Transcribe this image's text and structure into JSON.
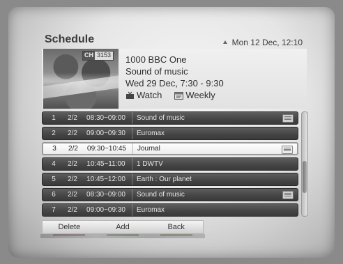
{
  "header": {
    "title": "Schedule",
    "datetime": "Mon 12 Dec, 12:10"
  },
  "program": {
    "channel_badge_label": "CH",
    "channel_badge_number": "3153",
    "channel": "1000 BBC One",
    "title": "Sound of music",
    "time": "Wed 29 Dec, 7:30 - 9:30",
    "watch_label": "Watch",
    "weekly_label": "Weekly"
  },
  "schedule": {
    "rows": [
      {
        "num": "1",
        "ep": "2/2",
        "time": "08:30~09:00",
        "name": "Sound of music",
        "icon": "weekly-icon",
        "selected": false
      },
      {
        "num": "2",
        "ep": "2/2",
        "time": "09:00~09:30",
        "name": "Euromax",
        "icon": "",
        "selected": false
      },
      {
        "num": "3",
        "ep": "2/2",
        "time": "09:30~10:45",
        "name": "Journal",
        "icon": "weekly-icon",
        "selected": true
      },
      {
        "num": "4",
        "ep": "2/2",
        "time": "10:45~11:00",
        "name": "1 DWTV",
        "icon": "",
        "selected": false
      },
      {
        "num": "5",
        "ep": "2/2",
        "time": "10:45~12:00",
        "name": "Earth : Our planet",
        "icon": "",
        "selected": false
      },
      {
        "num": "6",
        "ep": "2/2",
        "time": "08:30~09:00",
        "name": "Sound of music",
        "icon": "weekly-icon",
        "selected": false
      },
      {
        "num": "7",
        "ep": "2/2",
        "time": "09:00~09:30",
        "name": "Euromax",
        "icon": "",
        "selected": false
      }
    ]
  },
  "buttons": {
    "delete": "Delete",
    "add": "Add",
    "back": "Back"
  },
  "colors": {
    "row_bg": "#444444",
    "selected_row_bg": "#ffffff",
    "delete_key": "#8d6b6b",
    "add_key": "#6f8a6f",
    "back_key": "#8a8a6a"
  }
}
